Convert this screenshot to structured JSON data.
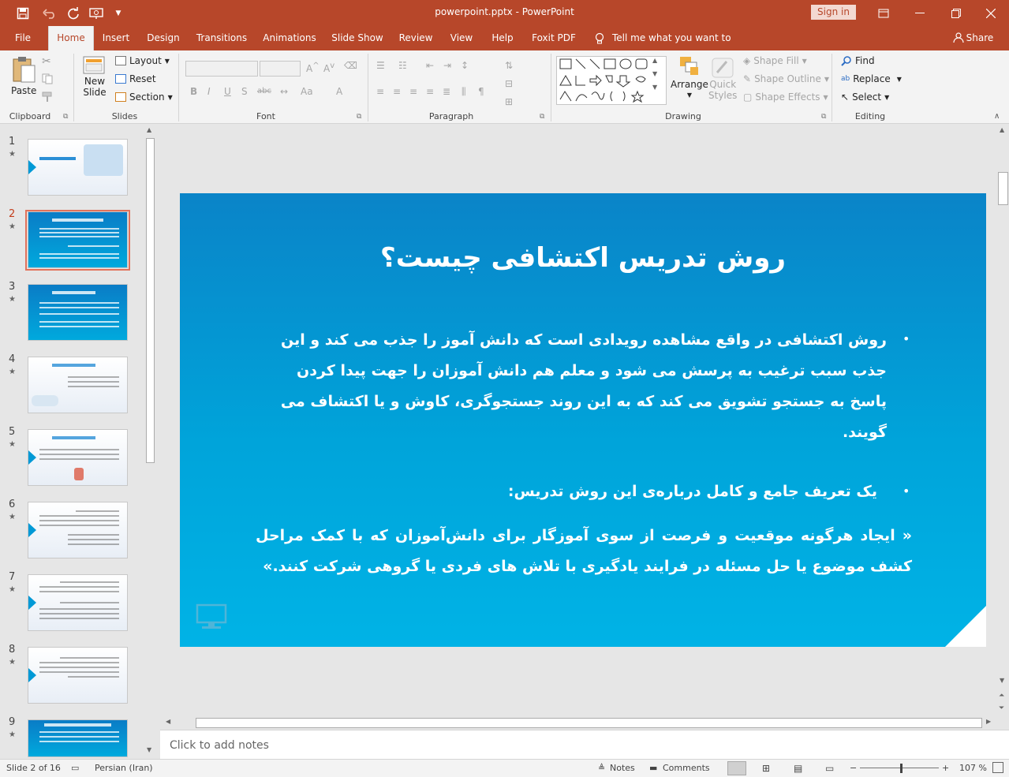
{
  "window": {
    "title": "powerpoint.pptx  -  PowerPoint",
    "signin": "Sign in"
  },
  "tabs": [
    "File",
    "Home",
    "Insert",
    "Design",
    "Transitions",
    "Animations",
    "Slide Show",
    "Review",
    "View",
    "Help",
    "Foxit PDF"
  ],
  "tell_me": "Tell me what you want to do",
  "share": "Share",
  "ribbon": {
    "clipboard": {
      "label": "Clipboard",
      "paste": "Paste"
    },
    "slides": {
      "label": "Slides",
      "new_slide_1": "New",
      "new_slide_2": "Slide",
      "layout": "Layout",
      "reset": "Reset",
      "section": "Section"
    },
    "font": {
      "label": "Font"
    },
    "paragraph": {
      "label": "Paragraph"
    },
    "drawing": {
      "label": "Drawing",
      "arrange": "Arrange",
      "quick_styles_1": "Quick",
      "quick_styles_2": "Styles",
      "shape_fill": "Shape Fill",
      "shape_outline": "Shape Outline",
      "shape_effects": "Shape Effects"
    },
    "editing": {
      "label": "Editing",
      "find": "Find",
      "replace": "Replace",
      "select": "Select"
    }
  },
  "thumbnails": [
    "1",
    "2",
    "3",
    "4",
    "5",
    "6",
    "7",
    "8",
    "9"
  ],
  "selected_slide": 2,
  "slide": {
    "title": "روش تدریس اکتشافی چیست؟",
    "para1": "روش اکتشافی در واقع مشاهده رویدادی است که دانش آموز را جذب می کند و این جذب سبب ترغیب به پرسش می شود و معلم هم دانش آموزان را جهت پیدا کردن پاسخ به جستجو تشویق می کند که به این روند جستجوگری، کاوش و یا اکتشاف می گویند.",
    "para2": "یک تعریف جامع و کامل درباره‌ی این روش تدریس:",
    "para3": "« ایجاد هرگونه موقعیت و فرصت از سوی آموزگار برای دانش‌آموزان که با کمک مراحل کشف موضوع یا حل مسئله در فرایند یادگیری با تلاش های فردی یا گروهی شرکت کنند.»"
  },
  "notes_placeholder": "Click to add notes",
  "status": {
    "slide_info": "Slide 2 of 16",
    "language": "Persian (Iran)",
    "notes": "Notes",
    "comments": "Comments",
    "zoom": "107 %"
  }
}
